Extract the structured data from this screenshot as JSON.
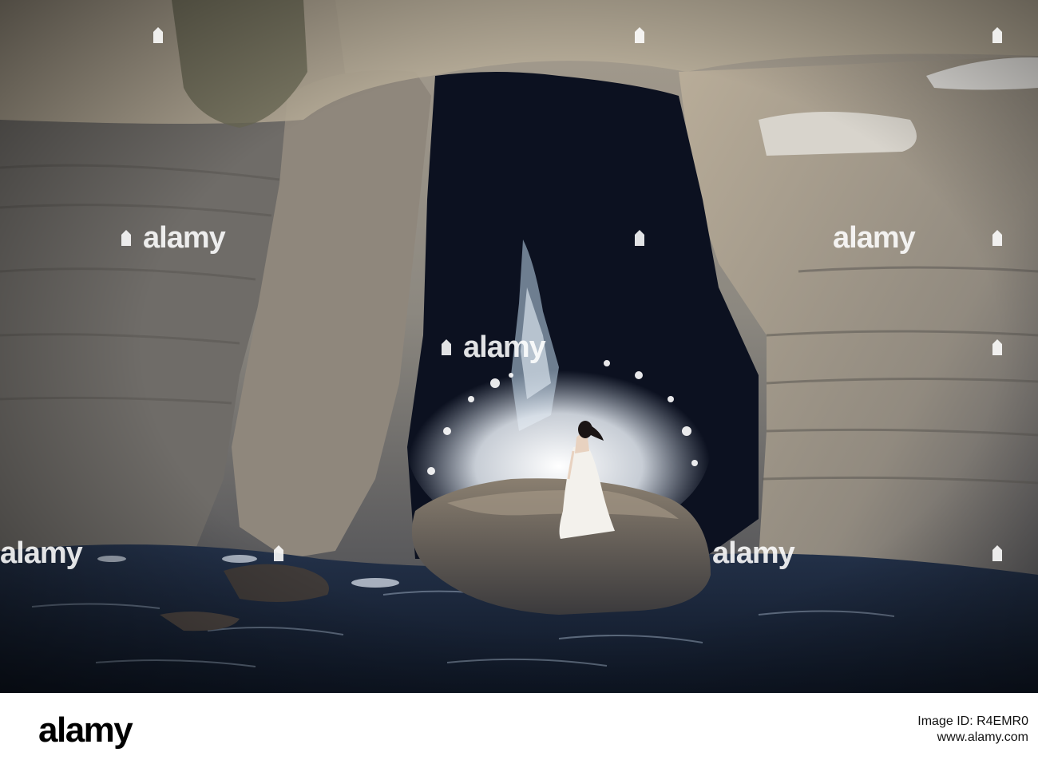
{
  "watermark": {
    "text": "alamy",
    "color": "#ffffff"
  },
  "footer": {
    "logo_text": "alamy",
    "id_label": "Image ID: R4EMR0",
    "url": "www.alamy.com"
  },
  "colors": {
    "cliff_light": "#b7ab98",
    "cliff_dark": "#4a4a52",
    "cave": "#0d1220",
    "sea": "#1a2638",
    "spray": "#ffffff",
    "dress": "#f4f2ee"
  }
}
